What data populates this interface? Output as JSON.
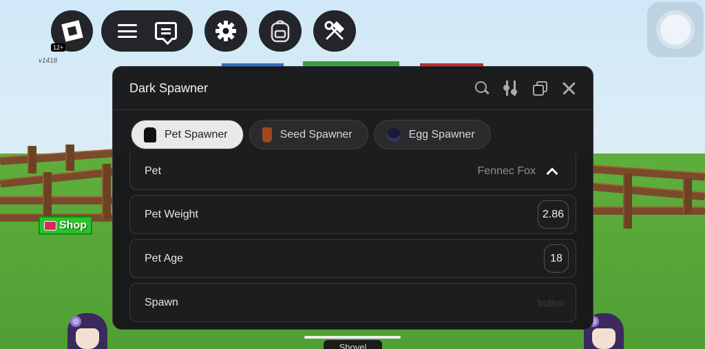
{
  "hud": {
    "age_rating": "12+",
    "version": "v1418",
    "shop_label": "Shop",
    "shovel_label": "Shovel"
  },
  "window": {
    "title": "Dark Spawner",
    "tabs": [
      {
        "label": "Pet Spawner",
        "icon": "paw-icon",
        "active": true
      },
      {
        "label": "Seed Spawner",
        "icon": "seed-icon",
        "active": false
      },
      {
        "label": "Egg Spawner",
        "icon": "egg-icon",
        "active": false
      }
    ],
    "pet_dropdown": {
      "label": "Pet",
      "value": "Fennec Fox"
    },
    "pet_weight": {
      "label": "Pet Weight",
      "value": "2.86"
    },
    "pet_age": {
      "label": "Pet Age",
      "value": "18"
    },
    "spawn": {
      "label": "Spawn",
      "hint": "button"
    }
  },
  "colors": {
    "window_bg": "#161618",
    "active_tab_bg": "#e9e9ea",
    "shop_green": "#2cc22c"
  }
}
